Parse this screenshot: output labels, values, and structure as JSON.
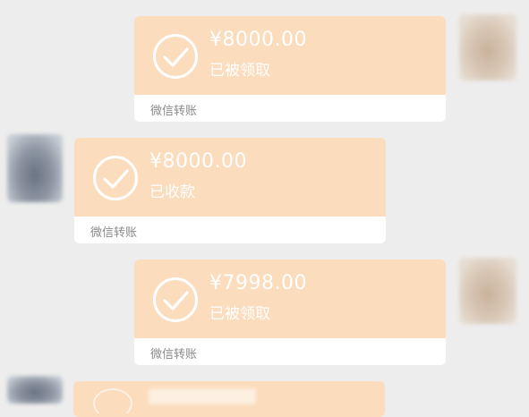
{
  "messages": [
    {
      "side": "right",
      "amount": "¥8000.00",
      "status": "已被领取",
      "label": "微信转账"
    },
    {
      "side": "left",
      "amount": "¥8000.00",
      "status": "已收款",
      "label": "微信转账"
    },
    {
      "side": "right",
      "amount": "¥7998.00",
      "status": "已被领取",
      "label": "微信转账"
    }
  ],
  "colors": {
    "card_top": "#fbdcbc",
    "card_bottom": "#ffffff",
    "background": "#ededed",
    "label_text": "#8a8a8a"
  },
  "icons": {
    "status": "check-circle-icon"
  }
}
